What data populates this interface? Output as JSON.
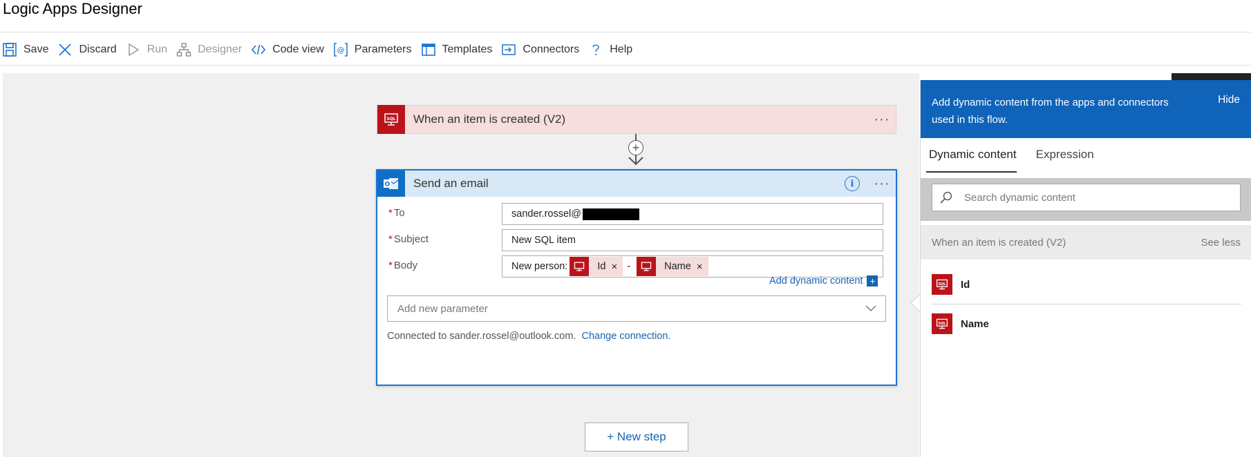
{
  "app": {
    "title": "Logic Apps Designer"
  },
  "toolbar": {
    "items": [
      {
        "label": "Save",
        "icon": "save-icon",
        "disabled": false
      },
      {
        "label": "Discard",
        "icon": "close-icon",
        "disabled": false
      },
      {
        "label": "Run",
        "icon": "play-icon",
        "disabled": true
      },
      {
        "label": "Designer",
        "icon": "designer-icon",
        "disabled": true
      },
      {
        "label": "Code view",
        "icon": "code-icon",
        "disabled": false
      },
      {
        "label": "Parameters",
        "icon": "parameters-icon",
        "disabled": false
      },
      {
        "label": "Templates",
        "icon": "templates-icon",
        "disabled": false
      },
      {
        "label": "Connectors",
        "icon": "connectors-icon",
        "disabled": false
      },
      {
        "label": "Help",
        "icon": "help-icon",
        "disabled": false
      }
    ]
  },
  "trigger": {
    "title": "When an item is created (V2)",
    "icon": "sql-icon",
    "more": "···"
  },
  "action": {
    "title": "Send an email",
    "icon": "outlook-icon",
    "more": "···",
    "fields": {
      "to": {
        "label": "To",
        "value": "sander.rossel@"
      },
      "subject": {
        "label": "Subject",
        "value": "New SQL item"
      },
      "body": {
        "label": "Body",
        "prefix": "New person:",
        "tokens": [
          "Id",
          "Name"
        ],
        "separator": "-"
      }
    },
    "required_marker": "*",
    "add_dynamic_label": "Add dynamic content",
    "add_param_placeholder": "Add new parameter",
    "connected_text": "Connected to sander.rossel@outlook.com.",
    "change_connection": "Change connection."
  },
  "new_step": "+ New step",
  "dynamic_panel": {
    "header_text": "Add dynamic content from the apps and connectors used in this flow.",
    "hide_label": "Hide",
    "tabs": [
      {
        "label": "Dynamic content",
        "active": true
      },
      {
        "label": "Expression",
        "active": false
      }
    ],
    "search_placeholder": "Search dynamic content",
    "group_title": "When an item is created (V2)",
    "see_less": "See less",
    "items": [
      {
        "label": "Id"
      },
      {
        "label": "Name"
      }
    ]
  },
  "colors": {
    "sql_red": "#ba141a",
    "outlook_blue": "#0f6ec6",
    "accent_blue": "#1764b0",
    "panel_header": "#0f63b8",
    "trigger_bg": "#f7dede"
  }
}
